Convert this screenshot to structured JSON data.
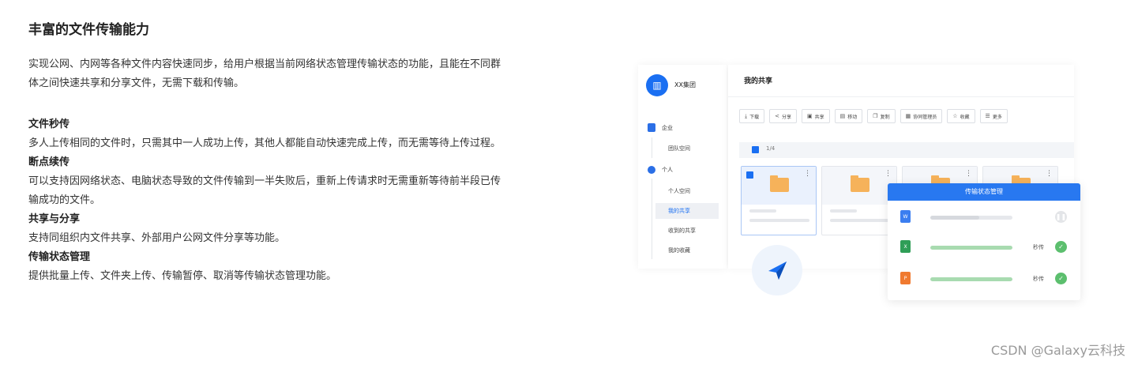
{
  "heading": "丰富的文件传输能力",
  "intro_lines": [
    "实现公网、内网等各种文件内容快速同步，给用户根据当前网络状态管理传输状态的功能，且能在不同群",
    "体之间快速共享和分享文件，无需下载和传输。"
  ],
  "features": [
    {
      "title": "文件秒传",
      "desc_lines": [
        "多人上传相同的文件时，只需其中一人成功上传，其他人都能自动快速完成上传，而无需等待上传过程。"
      ]
    },
    {
      "title": "断点续传",
      "desc_lines": [
        "可以支持因网络状态、电脑状态导致的文件传输到一半失败后，重新上传请求时无需重新等待前半段已传",
        "输成功的文件。"
      ]
    },
    {
      "title": "共享与分享",
      "desc_lines": [
        "支持同组织内文件共享、外部用户公网文件分享等功能。"
      ]
    },
    {
      "title": "传输状态管理",
      "desc_lines": [
        "提供批量上传、文件夹上传、传输暂停、取消等传输状态管理功能。"
      ]
    }
  ],
  "app": {
    "brand": "XX集团",
    "sidebar": {
      "group_enterprise": "企业",
      "team_space": "团队空间",
      "group_personal": "个人",
      "personal_items": [
        "个人空间",
        "我的共享",
        "收到的共享",
        "我的收藏"
      ],
      "active_item": "我的共享"
    },
    "page_title": "我的共享",
    "toolbar": [
      {
        "icon": "download-icon",
        "label": "下载"
      },
      {
        "icon": "share-icon",
        "label": "分享"
      },
      {
        "icon": "co-share-icon",
        "label": "共享"
      },
      {
        "icon": "move-icon",
        "label": "移动"
      },
      {
        "icon": "copy-icon",
        "label": "复制"
      },
      {
        "icon": "collab-icon",
        "label": "协同管理员"
      },
      {
        "icon": "star-icon",
        "label": "收藏"
      },
      {
        "icon": "more-icon",
        "label": "更多"
      }
    ],
    "selection_count": "1/4",
    "transfer_panel": {
      "title": "传输状态管理",
      "rows": [
        {
          "file_type": "W",
          "color": "#3b7ef0",
          "progress": 0.6,
          "status": "",
          "state": "paused"
        },
        {
          "file_type": "X",
          "color": "#2f9e57",
          "progress": 1.0,
          "status": "秒传",
          "state": "done"
        },
        {
          "file_type": "P",
          "color": "#f07a30",
          "progress": 1.0,
          "status": "秒传",
          "state": "done"
        }
      ]
    }
  },
  "watermark": "CSDN @Galaxy云科技"
}
